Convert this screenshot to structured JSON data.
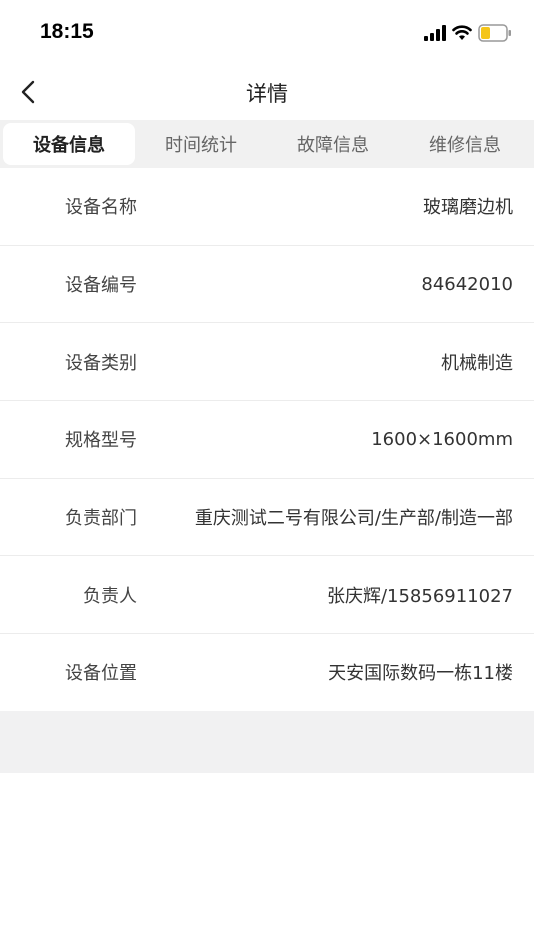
{
  "status_bar": {
    "time": "18:15"
  },
  "nav": {
    "title": "详情"
  },
  "tabs": [
    {
      "label": "设备信息",
      "active": true
    },
    {
      "label": "时间统计",
      "active": false
    },
    {
      "label": "故障信息",
      "active": false
    },
    {
      "label": "维修信息",
      "active": false
    }
  ],
  "fields": [
    {
      "label": "设备名称",
      "value": "玻璃磨边机"
    },
    {
      "label": "设备编号",
      "value": "84642010"
    },
    {
      "label": "设备类别",
      "value": "机械制造"
    },
    {
      "label": "规格型号",
      "value": "1600×1600mm"
    },
    {
      "label": "负责部门",
      "value": "重庆测试二号有限公司/生产部/制造一部"
    },
    {
      "label": "负责人",
      "value": "张庆辉/15856911027"
    },
    {
      "label": "设备位置",
      "value": "天安国际数码一栋11楼"
    }
  ],
  "colors": {
    "battery_fill": "#f5c518",
    "active_tab_bg": "#ffffff",
    "tab_bar_bg": "#f1f1f1"
  }
}
